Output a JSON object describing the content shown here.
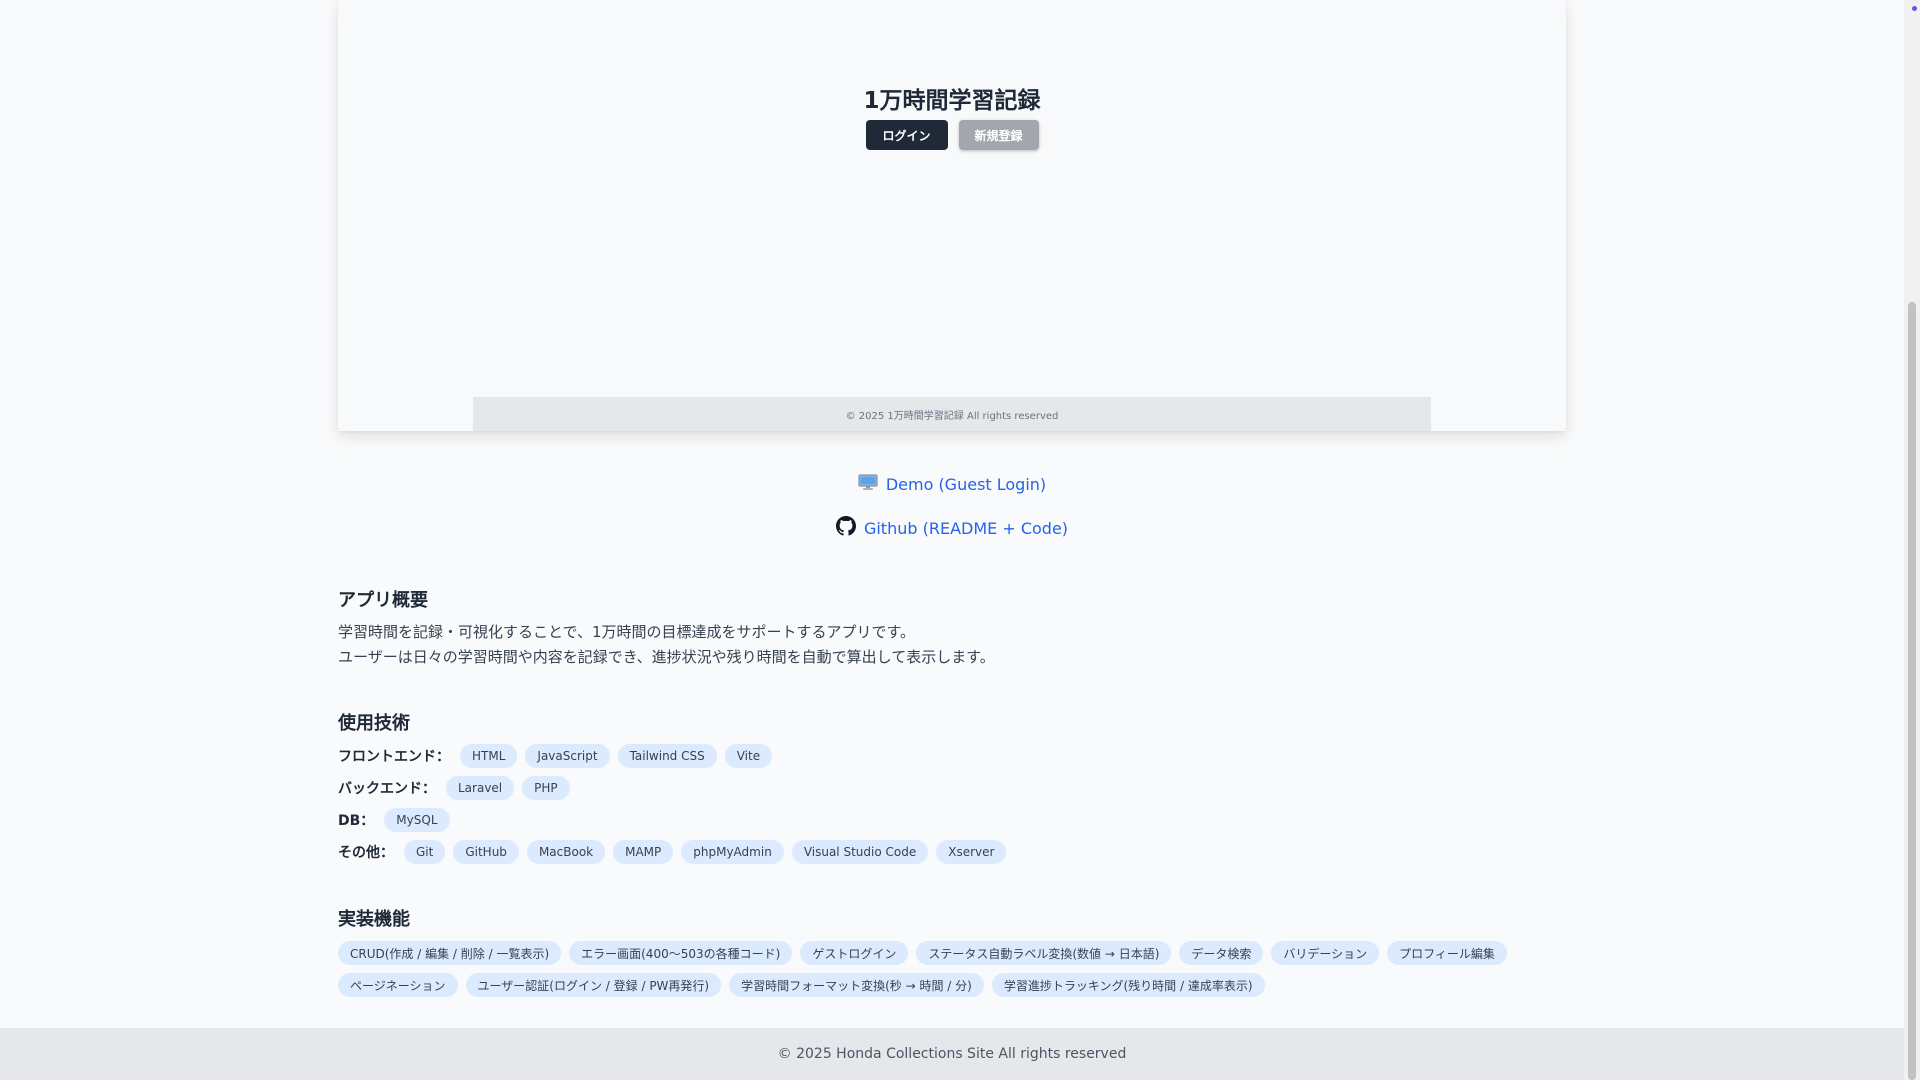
{
  "preview": {
    "title": "1万時間学習記録",
    "login_label": "ログイン",
    "register_label": "新規登録",
    "footer": "©  2025  1万時間学習記録  All rights reserved"
  },
  "links": {
    "demo": "Demo (Guest Login)",
    "github": "Github (README + Code)"
  },
  "overview": {
    "heading": "アプリ概要",
    "line1": "学習時間を記録・可視化することで、1万時間の目標達成をサポートするアプリです。",
    "line2": "ユーザーは日々の学習時間や内容を記録でき、進捗状況や残り時間を自動で算出して表示します。"
  },
  "tech": {
    "heading": "使用技術",
    "rows": [
      {
        "label": "フロントエンド：",
        "items": [
          "HTML",
          "JavaScript",
          "Tailwind CSS",
          "Vite"
        ]
      },
      {
        "label": "バックエンド：",
        "items": [
          "Laravel",
          "PHP"
        ]
      },
      {
        "label": "DB：",
        "items": [
          "MySQL"
        ]
      },
      {
        "label": "その他：",
        "items": [
          "Git",
          "GitHub",
          "MacBook",
          "MAMP",
          "phpMyAdmin",
          "Visual Studio Code",
          "Xserver"
        ]
      }
    ]
  },
  "features": {
    "heading": "実装機能",
    "items": [
      "CRUD(作成 / 編集 / 削除 / 一覧表示)",
      "エラー画面(400〜503の各種コード)",
      "ゲストログイン",
      "ステータス自動ラベル変換(数値 → 日本語)",
      "データ検索",
      "バリデーション",
      "プロフィール編集",
      "ページネーション",
      "ユーザー認証(ログイン / 登録 / PW再発行)",
      "学習時間フォーマット変換(秒 → 時間 / 分)",
      "学習進捗トラッキング(残り時間 / 達成率表示)"
    ]
  },
  "footer": {
    "text": "©  2025  Honda Collections Site  All rights reserved"
  }
}
